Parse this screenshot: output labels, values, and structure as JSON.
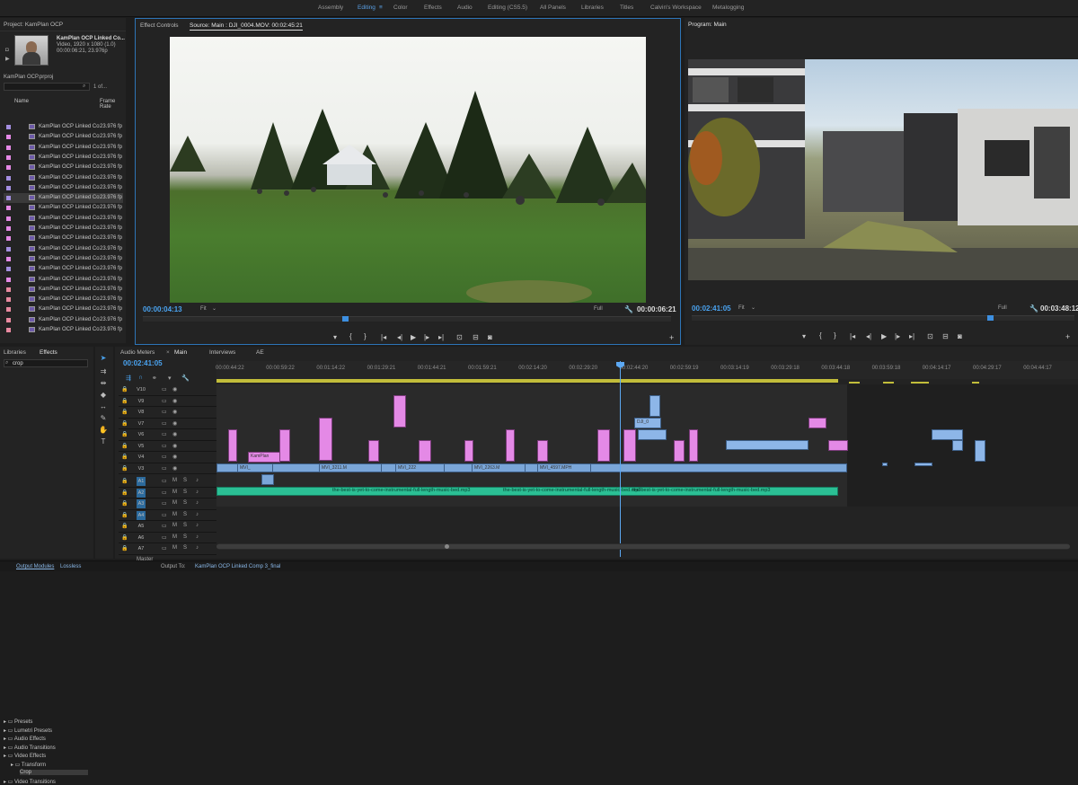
{
  "workspaces": [
    "Assembly",
    "Editing",
    "Color",
    "Effects",
    "Audio",
    "Editing (CS5.5)",
    "All Panels",
    "Libraries",
    "Titles",
    "Calvin's Workspace",
    "Metalogging"
  ],
  "active_workspace": "Editing",
  "project": {
    "tab": "Project: KamPlan OCP",
    "clip_name": "KamPlan OCP Linked Co...",
    "clip_meta1": "Video, 1920 x 1080 (1.0)",
    "clip_meta2": "00:00:06:21, 23.976p",
    "file": "KamPlan OCP.prproj",
    "count": "1 of...",
    "col_name": "Name",
    "col_rate": "Frame Rate",
    "rows": [
      {
        "name": "KamPlan OCP Linked Co",
        "rate": "23.976 fp",
        "color": "#a48ee0"
      },
      {
        "name": "KamPlan OCP Linked Co",
        "rate": "23.976 fp",
        "color": "#e489e6"
      },
      {
        "name": "KamPlan OCP Linked Co",
        "rate": "23.976 fp",
        "color": "#e489e6"
      },
      {
        "name": "KamPlan OCP Linked Co",
        "rate": "23.976 fp",
        "color": "#e489e6"
      },
      {
        "name": "KamPlan OCP Linked Co",
        "rate": "23.976 fp",
        "color": "#e489e6"
      },
      {
        "name": "KamPlan OCP Linked Co",
        "rate": "23.976 fp",
        "color": "#a48ee0"
      },
      {
        "name": "KamPlan OCP Linked Co",
        "rate": "23.976 fp",
        "color": "#a48ee0"
      },
      {
        "name": "KamPlan OCP Linked Co",
        "rate": "23.976 fp",
        "color": "#a48ee0"
      },
      {
        "name": "KamPlan OCP Linked Co",
        "rate": "23.976 fp",
        "color": "#e489e6"
      },
      {
        "name": "KamPlan OCP Linked Co",
        "rate": "23.976 fp",
        "color": "#e489e6"
      },
      {
        "name": "KamPlan OCP Linked Co",
        "rate": "23.976 fp",
        "color": "#e489e6"
      },
      {
        "name": "KamPlan OCP Linked Co",
        "rate": "23.976 fp",
        "color": "#e489e6"
      },
      {
        "name": "KamPlan OCP Linked Co",
        "rate": "23.976 fp",
        "color": "#a48ee0"
      },
      {
        "name": "KamPlan OCP Linked Co",
        "rate": "23.976 fp",
        "color": "#e489e6"
      },
      {
        "name": "KamPlan OCP Linked Co",
        "rate": "23.976 fp",
        "color": "#a48ee0"
      },
      {
        "name": "KamPlan OCP Linked Co",
        "rate": "23.976 fp",
        "color": "#e489e6"
      },
      {
        "name": "KamPlan OCP Linked Co",
        "rate": "23.976 fp",
        "color": "#e889a0"
      },
      {
        "name": "KamPlan OCP Linked Co",
        "rate": "23.976 fp",
        "color": "#e889a0"
      },
      {
        "name": "KamPlan OCP Linked Co",
        "rate": "23.976 fp",
        "color": "#e889a0"
      },
      {
        "name": "KamPlan OCP Linked Co",
        "rate": "23.976 fp",
        "color": "#e889a0"
      },
      {
        "name": "KamPlan OCP Linked Co",
        "rate": "23.976 fp",
        "color": "#e889a0"
      }
    ]
  },
  "source": {
    "tab_effect_controls": "Effect Controls",
    "tab_source": "Source: Main : DJI_0004.MOV: 00:02:45:21",
    "timecode": "00:00:04:13",
    "fit": "Fit",
    "quality": "Full",
    "duration": "00:00:06:21"
  },
  "program": {
    "tab": "Program: Main",
    "timecode": "00:02:41:05",
    "fit": "Fit",
    "quality": "Full",
    "duration": "00:03:48:12"
  },
  "effects": {
    "tab_libraries": "Libraries",
    "tab_effects": "Effects",
    "search": "crop",
    "tree": [
      "Presets",
      "Lumetri Presets",
      "Audio Effects",
      "Audio Transitions",
      "Video Effects",
      "Transform",
      "Crop",
      "Video Transitions"
    ]
  },
  "timeline": {
    "tab_audio_meters": "Audio Meters",
    "tab_main": "Main",
    "tab_interviews": "Interviews",
    "tab_ae": "AE",
    "timecode": "00:02:41:05",
    "ticks": [
      "00:00:44:22",
      "00:00:59:22",
      "00:01:14:22",
      "00:01:29:21",
      "00:01:44:21",
      "00:01:59:21",
      "00:02:14:20",
      "00:02:29:20",
      "00:02:44:20",
      "00:02:59:19",
      "00:03:14:19",
      "00:03:29:18",
      "00:03:44:18",
      "00:03:59:18",
      "00:04:14:17",
      "00:04:29:17",
      "00:04:44:17"
    ],
    "video_tracks": [
      "V10",
      "V9",
      "V8",
      "V7",
      "V6",
      "V5",
      "V4",
      "V3"
    ],
    "audio_tracks": [
      "A1",
      "A2",
      "A3",
      "A4",
      "A5",
      "A6",
      "A7"
    ],
    "master": "Master",
    "music_label": "the-best-is-yet-to-come-instrumental-full-length-music-bed.mp3",
    "clip_labels": {
      "kamplan": "KamPlan",
      "dji": "DJI_0",
      "mvi1": "MVI_",
      "mvi2": "MVI_3211.M",
      "mvi3": "MVI_222",
      "mvi4": "MVI_2263.M",
      "mvi5": "MVI_4597.MPH"
    }
  },
  "status": {
    "output_modules": "Output Modules",
    "lossless": "Lossless",
    "output_to": "Output To:",
    "file": "KamPlan OCP Linked Comp 3_final"
  }
}
